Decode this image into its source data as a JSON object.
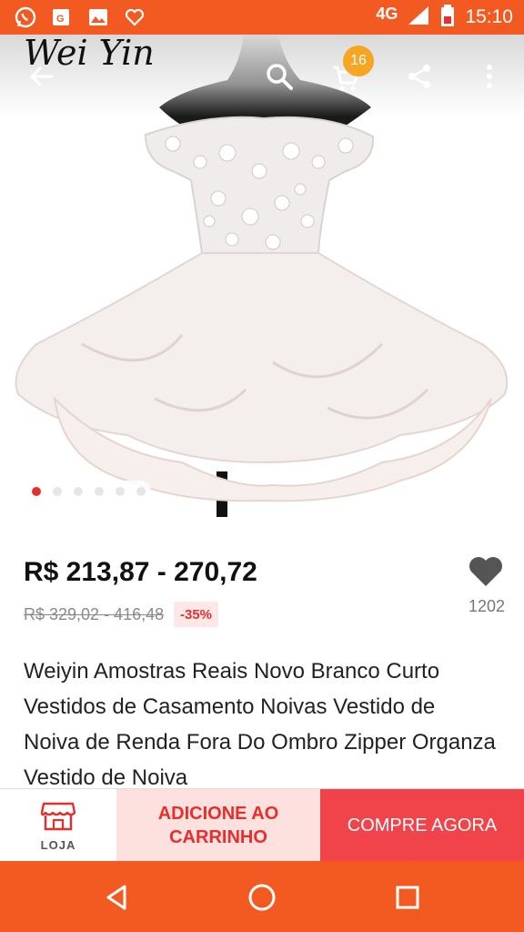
{
  "status_bar": {
    "network": "4G",
    "time": "15:10",
    "icons": [
      "whatsapp-icon",
      "gallery-icon",
      "image-icon",
      "heart-outline-icon",
      "signal-icon",
      "battery-icon"
    ]
  },
  "header": {
    "brand": "Wei Yin",
    "cart_count": "16",
    "icons": [
      "back-arrow-icon",
      "search-icon",
      "cart-icon",
      "share-icon",
      "more-vertical-icon"
    ]
  },
  "gallery": {
    "total_images": 6,
    "active_index": 0
  },
  "product": {
    "price": "R$ 213,87 - 270,72",
    "old_price": "R$ 329,02 - 416,48",
    "discount": "-35%",
    "wishlist_count": "1202",
    "title": "Weiyin Amostras Reais Novo Branco Curto Vestidos de Casamento Noivas Vestido de Noiva de Renda Fora Do Ombro Zipper Organza Vestido de Noiva"
  },
  "actions": {
    "store_label": "LOJA",
    "add_to_cart": "ADICIONE AO CARRINHO",
    "buy_now": "COMPRE AGORA"
  },
  "colors": {
    "brand_orange": "#F25A22",
    "accent_red": "#E62E2E",
    "buy_button": "#F0444A",
    "add_button_bg": "#FDE1DE",
    "badge": "#F5A623"
  }
}
